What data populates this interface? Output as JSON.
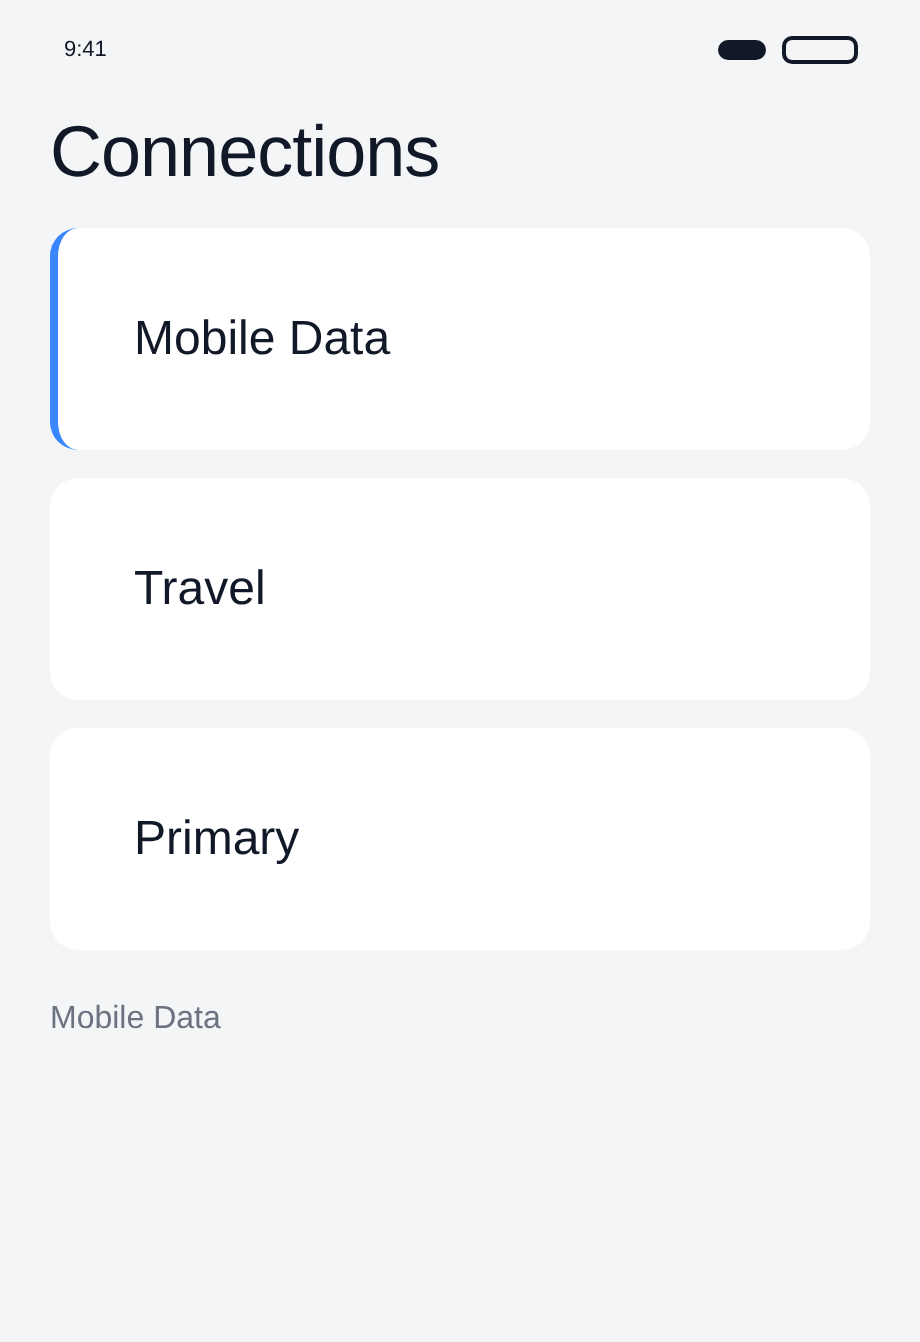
{
  "status_bar": {
    "time": "9:41"
  },
  "title": "Connections",
  "options": [
    {
      "label": "Mobile Data",
      "selected": true
    },
    {
      "label": "Travel",
      "selected": false
    },
    {
      "label": "Primary",
      "selected": false
    }
  ],
  "footer": "Mobile Data"
}
